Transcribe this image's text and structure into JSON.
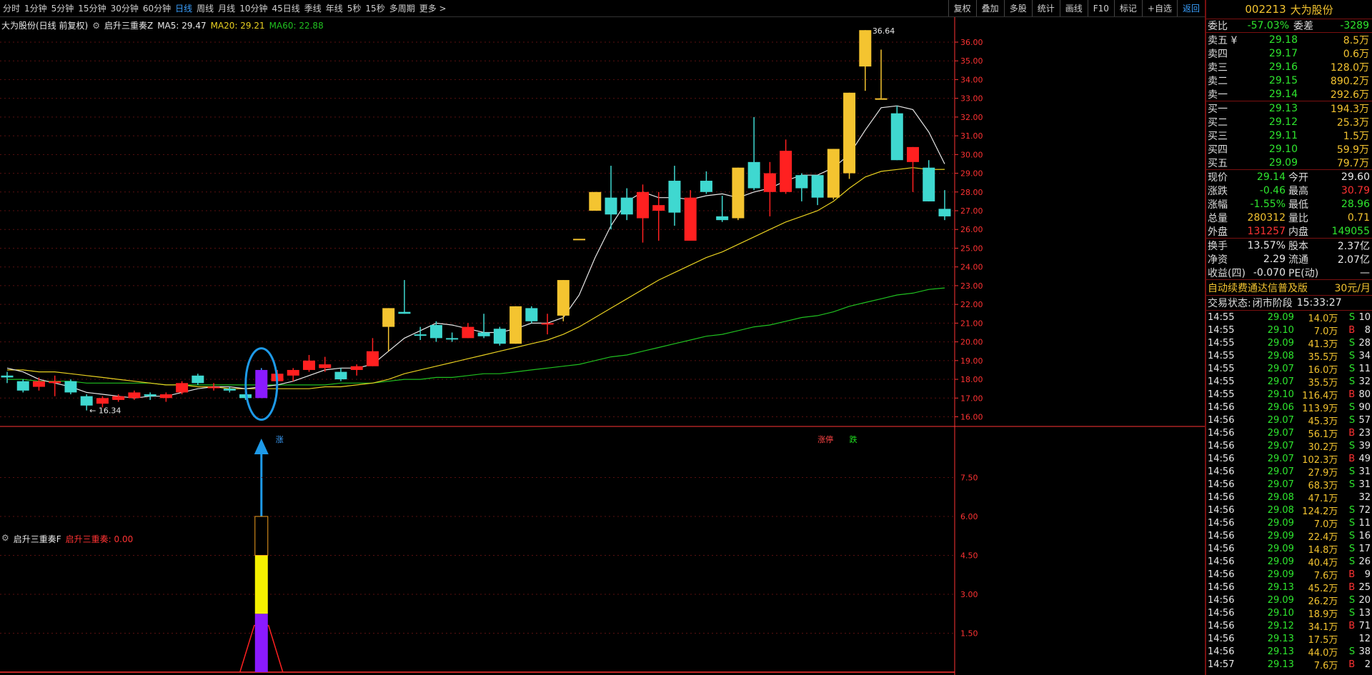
{
  "toolbar": {
    "periods": [
      "分时",
      "1分钟",
      "5分钟",
      "15分钟",
      "30分钟",
      "60分钟",
      "日线",
      "周线",
      "月线",
      "10分钟",
      "45日线",
      "季线",
      "年线",
      "5秒",
      "15秒",
      "多周期",
      "更多 >"
    ],
    "active_period_index": 6,
    "right_buttons": [
      "复权",
      "叠加",
      "多股",
      "统计",
      "画线",
      "F10",
      "标记",
      "+自选",
      "返回"
    ]
  },
  "main_chart": {
    "title": "大为股份(日线 前复权)",
    "indicator_name": "启升三重奏Z",
    "ma5_label": "MA5: 29.47",
    "ma20_label": "MA20: 29.21",
    "ma60_label": "MA60: 22.88",
    "high_marker": "36.64",
    "low_marker": "16.34",
    "signal_label": "涨",
    "label_up": "涨停",
    "label_down": "跌",
    "colors": {
      "up": "#ff2020",
      "down": "#3fd8d0",
      "limit": "#f4c430",
      "signal": "#8a1aff",
      "ma5": "#e8e8e8",
      "ma20": "#e8d020",
      "ma60": "#20c020",
      "axis": "#ff3333",
      "grid": "#5a1010"
    }
  },
  "chart_data": {
    "type": "candlestick",
    "y_ticks": [
      "36.00",
      "35.00",
      "34.00",
      "33.00",
      "32.00",
      "31.00",
      "30.00",
      "29.00",
      "28.00",
      "27.00",
      "26.00",
      "25.00",
      "24.00",
      "23.00",
      "22.00",
      "21.00",
      "20.00",
      "19.00",
      "18.00",
      "17.00",
      "16.00"
    ],
    "ylim": [
      15.6,
      36.8
    ],
    "candles": [
      [
        18.1,
        18.2,
        18.4,
        17.8,
        "down"
      ],
      [
        17.9,
        17.4,
        18.0,
        17.3,
        "down"
      ],
      [
        17.6,
        17.9,
        18.1,
        17.4,
        "up"
      ],
      [
        17.8,
        17.9,
        18.2,
        17.1,
        "up"
      ],
      [
        17.9,
        17.3,
        18.0,
        17.2,
        "down"
      ],
      [
        17.1,
        16.6,
        17.2,
        16.34,
        "down"
      ],
      [
        16.7,
        17.0,
        17.1,
        16.5,
        "up"
      ],
      [
        16.9,
        17.1,
        17.2,
        16.8,
        "up"
      ],
      [
        17.0,
        17.3,
        17.4,
        16.9,
        "up"
      ],
      [
        17.2,
        17.1,
        17.3,
        16.9,
        "down"
      ],
      [
        17.0,
        17.2,
        17.3,
        16.8,
        "up"
      ],
      [
        17.3,
        17.8,
        17.9,
        17.2,
        "up"
      ],
      [
        17.8,
        18.2,
        18.3,
        17.7,
        "down"
      ],
      [
        17.6,
        17.6,
        17.8,
        17.4,
        "up"
      ],
      [
        17.5,
        17.4,
        17.6,
        17.3,
        "down"
      ],
      [
        17.2,
        17.0,
        17.4,
        16.9,
        "down"
      ],
      [
        17.0,
        18.5,
        18.6,
        17.0,
        "signal"
      ],
      [
        17.9,
        18.3,
        18.5,
        17.8,
        "up"
      ],
      [
        18.2,
        18.5,
        18.6,
        17.9,
        "up"
      ],
      [
        18.5,
        19.0,
        19.3,
        18.4,
        "up"
      ],
      [
        18.6,
        18.8,
        19.2,
        18.4,
        "up"
      ],
      [
        18.4,
        18.0,
        18.6,
        17.9,
        "down"
      ],
      [
        18.5,
        18.7,
        18.8,
        18.2,
        "up"
      ],
      [
        18.7,
        19.5,
        20.2,
        18.7,
        "up"
      ],
      [
        20.8,
        21.8,
        21.8,
        19.5,
        "limit"
      ],
      [
        21.6,
        21.5,
        23.3,
        21.5,
        "down"
      ],
      [
        20.4,
        20.4,
        20.8,
        20.1,
        "down"
      ],
      [
        20.9,
        20.2,
        21.1,
        20.0,
        "down"
      ],
      [
        20.2,
        20.2,
        20.5,
        20.0,
        "down"
      ],
      [
        20.2,
        20.8,
        21.0,
        20.2,
        "up"
      ],
      [
        20.5,
        20.3,
        21.5,
        20.2,
        "down"
      ],
      [
        20.7,
        19.9,
        20.8,
        19.8,
        "down"
      ],
      [
        19.9,
        21.9,
        21.9,
        19.9,
        "limit"
      ],
      [
        21.8,
        21.1,
        21.9,
        21.0,
        "down"
      ],
      [
        21.0,
        21.0,
        21.5,
        20.4,
        "up"
      ],
      [
        21.4,
        23.3,
        23.3,
        21.1,
        "limit"
      ],
      [
        25.5,
        25.5,
        25.5,
        25.5,
        "limit"
      ],
      [
        27.0,
        28.0,
        28.0,
        27.0,
        "limit"
      ],
      [
        27.7,
        26.8,
        29.4,
        26.0,
        "down"
      ],
      [
        26.8,
        27.7,
        28.2,
        26.5,
        "down"
      ],
      [
        26.6,
        28.0,
        28.4,
        25.3,
        "up"
      ],
      [
        27.3,
        27.0,
        28.0,
        25.4,
        "up"
      ],
      [
        26.9,
        28.6,
        29.4,
        26.2,
        "down"
      ],
      [
        25.4,
        27.7,
        28.1,
        25.4,
        "up"
      ],
      [
        28.6,
        28.0,
        29.1,
        27.9,
        "down"
      ],
      [
        26.7,
        26.5,
        27.8,
        26.4,
        "down"
      ],
      [
        26.6,
        29.3,
        29.3,
        26.5,
        "limit"
      ],
      [
        29.6,
        28.2,
        32.0,
        28.1,
        "down"
      ],
      [
        28.0,
        29.0,
        29.6,
        26.7,
        "up"
      ],
      [
        28.0,
        30.2,
        30.8,
        27.9,
        "up"
      ],
      [
        28.2,
        28.9,
        29.0,
        27.5,
        "down"
      ],
      [
        28.9,
        27.7,
        28.8,
        27.3,
        "down"
      ],
      [
        27.7,
        30.3,
        30.3,
        27.6,
        "limit"
      ],
      [
        29.0,
        33.3,
        33.3,
        28.7,
        "limit"
      ],
      [
        34.7,
        36.64,
        36.64,
        33.4,
        "limit"
      ],
      [
        33.0,
        33.0,
        35.6,
        33.0,
        "limit"
      ],
      [
        32.2,
        29.7,
        32.6,
        29.7,
        "down"
      ],
      [
        30.4,
        29.6,
        30.4,
        28.0,
        "up"
      ],
      [
        29.3,
        27.5,
        29.7,
        27.5,
        "down"
      ],
      [
        27.1,
        26.7,
        28.1,
        26.5,
        "down"
      ]
    ],
    "ma5": [
      18.6,
      18.4,
      18.0,
      17.8,
      17.6,
      17.3,
      17.2,
      17.1,
      17.0,
      17.1,
      17.1,
      17.3,
      17.5,
      17.6,
      17.6,
      17.5,
      17.6,
      17.7,
      17.9,
      18.2,
      18.5,
      18.6,
      18.6,
      18.8,
      19.5,
      20.2,
      20.6,
      21.0,
      20.9,
      20.7,
      20.5,
      20.5,
      20.7,
      21.0,
      21.0,
      21.3,
      22.5,
      24.5,
      26.2,
      27.5,
      28.0,
      27.7,
      27.7,
      27.6,
      27.8,
      27.9,
      27.7,
      28.0,
      28.2,
      28.6,
      28.9,
      28.9,
      29.3,
      30.0,
      31.3,
      32.5,
      32.6,
      32.4,
      31.2,
      29.5
    ],
    "ma20": [
      18.5,
      18.5,
      18.4,
      18.4,
      18.3,
      18.2,
      18.1,
      18.0,
      17.9,
      17.8,
      17.7,
      17.7,
      17.6,
      17.6,
      17.5,
      17.5,
      17.5,
      17.5,
      17.5,
      17.5,
      17.6,
      17.6,
      17.7,
      17.8,
      18.0,
      18.3,
      18.5,
      18.7,
      18.9,
      19.1,
      19.3,
      19.5,
      19.7,
      19.9,
      20.1,
      20.4,
      20.8,
      21.3,
      21.8,
      22.3,
      22.8,
      23.3,
      23.7,
      24.1,
      24.5,
      24.8,
      25.2,
      25.6,
      26.0,
      26.4,
      26.7,
      27.0,
      27.5,
      28.2,
      28.8,
      29.1,
      29.2,
      29.3,
      29.2,
      29.21
    ],
    "ma60": [
      18.0,
      18.0,
      17.9,
      17.9,
      17.9,
      17.8,
      17.8,
      17.8,
      17.8,
      17.8,
      17.7,
      17.7,
      17.7,
      17.7,
      17.7,
      17.7,
      17.7,
      17.7,
      17.7,
      17.7,
      17.7,
      17.8,
      17.8,
      17.8,
      17.9,
      18.0,
      18.0,
      18.1,
      18.1,
      18.2,
      18.3,
      18.3,
      18.4,
      18.5,
      18.6,
      18.7,
      18.8,
      19.0,
      19.2,
      19.3,
      19.5,
      19.7,
      19.9,
      20.1,
      20.3,
      20.4,
      20.6,
      20.8,
      20.9,
      21.1,
      21.3,
      21.4,
      21.6,
      21.9,
      22.1,
      22.3,
      22.5,
      22.6,
      22.8,
      22.88
    ],
    "signal_index": 16
  },
  "sub_chart": {
    "title": "启升三重奏F",
    "value_label": "启升三重奏: 0.00",
    "y_ticks": [
      "7.50",
      "6.00",
      "4.50",
      "3.00",
      "1.50"
    ],
    "ylim": [
      0,
      9
    ],
    "bar_values": {
      "purple": 2.25,
      "yellow": 2.25,
      "black": 1.5,
      "total": 6.0
    }
  },
  "quote": {
    "code": "002213",
    "name": "大为股份",
    "weibi_label": "委比",
    "weibi": "-57.03%",
    "weicha_label": "委差",
    "weicha": "-3289",
    "asks": [
      {
        "label": "卖五 ¥",
        "price": "29.18",
        "vol": "8.5万"
      },
      {
        "label": "卖四",
        "price": "29.17",
        "vol": "0.6万"
      },
      {
        "label": "卖三",
        "price": "29.16",
        "vol": "128.0万"
      },
      {
        "label": "卖二",
        "price": "29.15",
        "vol": "890.2万"
      },
      {
        "label": "卖一",
        "price": "29.14",
        "vol": "292.6万"
      }
    ],
    "bids": [
      {
        "label": "买一",
        "price": "29.13",
        "vol": "194.3万"
      },
      {
        "label": "买二",
        "price": "29.12",
        "vol": "25.3万"
      },
      {
        "label": "买三",
        "price": "29.11",
        "vol": "1.5万"
      },
      {
        "label": "买四",
        "price": "29.10",
        "vol": "59.9万"
      },
      {
        "label": "买五",
        "price": "29.09",
        "vol": "79.7万"
      }
    ],
    "stats": [
      {
        "a": "现价",
        "b": "29.14",
        "bc": "green",
        "c": "今开",
        "d": "29.60",
        "dc": "white"
      },
      {
        "a": "涨跌",
        "b": "-0.46",
        "bc": "green",
        "c": "最高",
        "d": "30.79",
        "dc": "red"
      },
      {
        "a": "涨幅",
        "b": "-1.55%",
        "bc": "green",
        "c": "最低",
        "d": "28.96",
        "dc": "green"
      },
      {
        "a": "总量",
        "b": "280312",
        "bc": "yellow",
        "c": "量比",
        "d": "0.71",
        "dc": "yellow"
      },
      {
        "a": "外盘",
        "b": "131257",
        "bc": "red",
        "c": "内盘",
        "d": "149055",
        "dc": "green"
      }
    ],
    "stats2": [
      {
        "a": "换手",
        "b": "13.57%",
        "bc": "white",
        "c": "股本",
        "d": "2.37亿",
        "dc": "white"
      },
      {
        "a": "净资",
        "b": "2.29",
        "bc": "white",
        "c": "流通",
        "d": "2.07亿",
        "dc": "white"
      },
      {
        "a": "收益(四)",
        "b": "-0.070",
        "bc": "white",
        "c": "PE(动)",
        "d": "—",
        "dc": "white"
      }
    ],
    "ad_text": "自动续费通达信普及版",
    "ad_price": "30元/月",
    "state_label": "交易状态:",
    "state_value": "闭市阶段",
    "state_time": "15:33:27",
    "ticks": [
      [
        "14:55",
        "29.09",
        "14.0万",
        "S",
        "10"
      ],
      [
        "14:55",
        "29.10",
        "7.0万",
        "B",
        "8"
      ],
      [
        "14:55",
        "29.09",
        "41.3万",
        "S",
        "28"
      ],
      [
        "14:55",
        "29.08",
        "35.5万",
        "S",
        "34"
      ],
      [
        "14:55",
        "29.07",
        "16.0万",
        "S",
        "11"
      ],
      [
        "14:55",
        "29.07",
        "35.5万",
        "S",
        "32"
      ],
      [
        "14:55",
        "29.10",
        "116.4万",
        "B",
        "80"
      ],
      [
        "14:56",
        "29.06",
        "113.9万",
        "S",
        "90"
      ],
      [
        "14:56",
        "29.07",
        "45.3万",
        "S",
        "57"
      ],
      [
        "14:56",
        "29.07",
        "56.1万",
        "B",
        "23"
      ],
      [
        "14:56",
        "29.07",
        "30.2万",
        "S",
        "39"
      ],
      [
        "14:56",
        "29.07",
        "102.3万",
        "B",
        "49"
      ],
      [
        "14:56",
        "29.07",
        "27.9万",
        "S",
        "31"
      ],
      [
        "14:56",
        "29.07",
        "68.3万",
        "S",
        "31"
      ],
      [
        "14:56",
        "29.08",
        "47.1万",
        "",
        "32"
      ],
      [
        "14:56",
        "29.08",
        "124.2万",
        "S",
        "72"
      ],
      [
        "14:56",
        "29.09",
        "7.0万",
        "S",
        "11"
      ],
      [
        "14:56",
        "29.09",
        "22.4万",
        "S",
        "16"
      ],
      [
        "14:56",
        "29.09",
        "14.8万",
        "S",
        "17"
      ],
      [
        "14:56",
        "29.09",
        "40.4万",
        "S",
        "26"
      ],
      [
        "14:56",
        "29.09",
        "7.6万",
        "B",
        "9"
      ],
      [
        "14:56",
        "29.13",
        "45.2万",
        "B",
        "25"
      ],
      [
        "14:56",
        "29.09",
        "26.2万",
        "S",
        "20"
      ],
      [
        "14:56",
        "29.10",
        "18.9万",
        "S",
        "13"
      ],
      [
        "14:56",
        "29.12",
        "34.1万",
        "B",
        "71"
      ],
      [
        "14:56",
        "29.13",
        "17.5万",
        "",
        "12"
      ],
      [
        "14:56",
        "29.13",
        "44.0万",
        "S",
        "38"
      ],
      [
        "14:57",
        "29.13",
        "7.6万",
        "B",
        "2"
      ]
    ]
  }
}
